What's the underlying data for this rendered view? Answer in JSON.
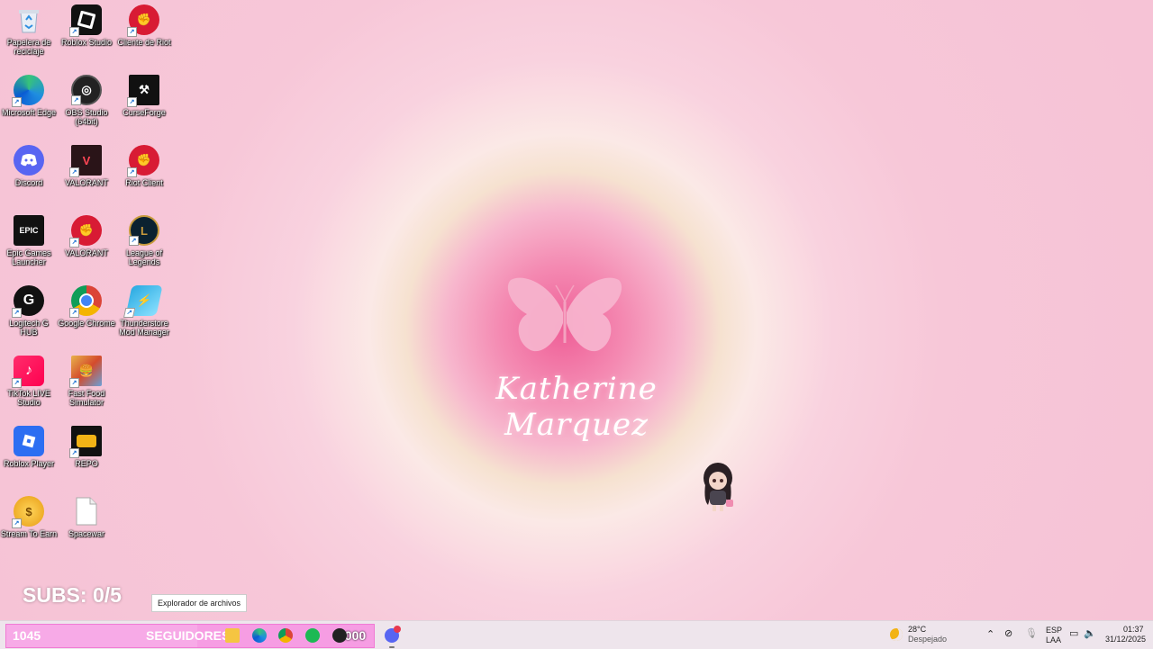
{
  "desktop_icons": [
    {
      "label": "Papelera de reciclaje",
      "icon": "recycle-bin-icon"
    },
    {
      "label": "Roblox Studio",
      "icon": "roblox-studio-icon"
    },
    {
      "label": "Cliente de Riot",
      "icon": "riot-client-icon"
    },
    {
      "label": "Microsoft Edge",
      "icon": "edge-icon"
    },
    {
      "label": "OBS Studio (64bit)",
      "icon": "obs-icon"
    },
    {
      "label": "CurseForge",
      "icon": "curseforge-icon"
    },
    {
      "label": "Discord",
      "icon": "discord-icon"
    },
    {
      "label": "VALORANT",
      "icon": "valorant-icon"
    },
    {
      "label": "Riot Client",
      "icon": "riot-client-icon"
    },
    {
      "label": "Epic Games Launcher",
      "icon": "epic-games-icon"
    },
    {
      "label": "VALORANT",
      "icon": "riot-client-icon"
    },
    {
      "label": "League of Legends",
      "icon": "league-icon"
    },
    {
      "label": "Logitech G HUB",
      "icon": "logitech-icon"
    },
    {
      "label": "Google Chrome",
      "icon": "chrome-icon"
    },
    {
      "label": "Thunderstore Mod Manager",
      "icon": "thunderstore-icon"
    },
    {
      "label": "TikTok LIVE Studio",
      "icon": "tiktok-icon"
    },
    {
      "label": "Fast Food Simulator",
      "icon": "game-icon"
    },
    {
      "label": "Roblox Player",
      "icon": "roblox-icon"
    },
    {
      "label": "REPO",
      "icon": "repo-icon"
    },
    {
      "label": "Stream To Earn",
      "icon": "coin-icon"
    },
    {
      "label": "Spacewar",
      "icon": "file-icon"
    }
  ],
  "wallpaper": {
    "signature": "Katherine Marquez"
  },
  "overlay": {
    "subs": "SUBS: 0/5",
    "followers_count": "1045",
    "followers_label": "SEGUIDORES",
    "followers_goal": "2000",
    "followers_progress": 0.52
  },
  "tooltip": "Explorador de archivos",
  "tray": {
    "temperature": "28°C",
    "weather": "Despejado",
    "lang_line1": "ESP",
    "lang_line2": "LAA",
    "time": "01:37",
    "date": "31/12/2025"
  },
  "colors": {
    "followers_bar": "#f69de3",
    "accent": "#ef5f97"
  }
}
